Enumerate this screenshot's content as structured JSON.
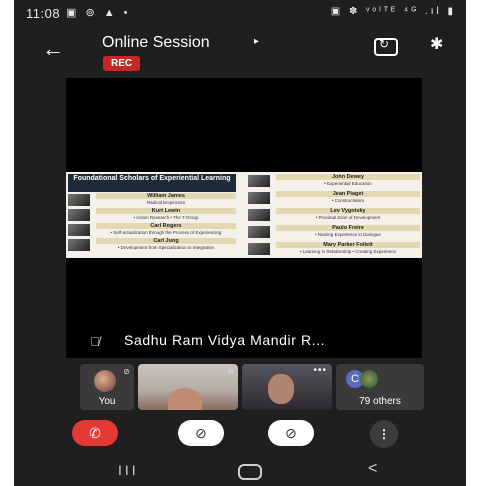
{
  "status_bar": {
    "time": "11:08",
    "left_icons": "▣ ⊚ ▲ •",
    "right_icons": "▣ ✽ ᵛᵒˡᵀᴱ ⁴ᴳ .ıl ▮"
  },
  "header": {
    "back_icon": "arrow-left",
    "title": "Online Session",
    "title_caret": "▸",
    "rec_badge": "REC",
    "switch_camera_icon": "camera-switch",
    "bluetooth_icon": "bluetooth"
  },
  "presentation": {
    "slide": {
      "heading": "Foundational Scholars of Experiential Learning",
      "left_scholars": [
        {
          "name": "William James",
          "note": "Radical Empiricism"
        },
        {
          "name": "Kurt Lewin",
          "note": "• Action Research • The T-Group"
        },
        {
          "name": "Carl Rogers",
          "note": "• Self-actualization through the Process of Experiencing"
        },
        {
          "name": "Carl Jung",
          "note": "• Development from Specialization to Integration"
        }
      ],
      "right_scholars": [
        {
          "name": "John Dewey",
          "note": "• Experiential Education"
        },
        {
          "name": "Jean Piaget",
          "note": "• Constructivism"
        },
        {
          "name": "Lev Vygotsky",
          "note": "• Proximal Zone of Development"
        },
        {
          "name": "Paulo Freire",
          "note": "• Naming Experience in Dialogue"
        },
        {
          "name": "Mary Parker Follett",
          "note": "• Learning in Relationship • Creating Experience"
        }
      ]
    },
    "presenter_name": "Sadhu Ram Vidya Mandir R..."
  },
  "participants": {
    "you_label": "You",
    "others_initial": "C",
    "others_label": "79 others",
    "more_dots": "•••"
  },
  "controls": {
    "end_call": "✆",
    "camera_off": "⊘",
    "mic_off": "⊘",
    "more": "⋮"
  },
  "navbar": {
    "recents": "III",
    "back": "<"
  }
}
